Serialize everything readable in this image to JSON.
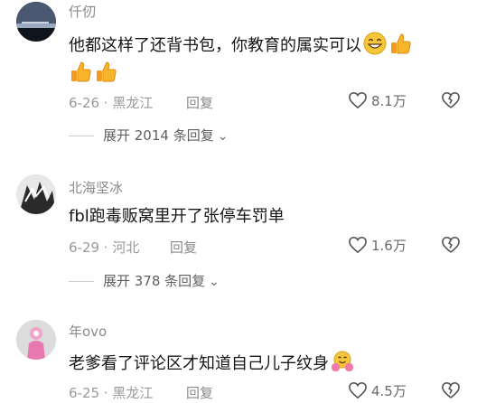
{
  "comments": [
    {
      "username": "仟仞",
      "text": "他都这样了还背书包，你教育的属实可以",
      "meta": "6-26 · 黑龙江",
      "reply_label": "回复",
      "likes": "8.1万",
      "expand_label": "展开 2014 条回复",
      "emojis": [
        "grinning-emoji",
        "thumbs-up-emoji",
        "thumbs-up-emoji",
        "thumbs-up-emoji"
      ]
    },
    {
      "username": "北海坚冰",
      "text": "fbl跑毒贩窝里开了张停车罚单",
      "meta": "6-29 · 河北",
      "reply_label": "回复",
      "likes": "1.6万",
      "expand_label": "展开 378 条回复"
    },
    {
      "username": "年ovo",
      "text": "老爹看了评论区才知道自己儿子纹身",
      "meta": "6-25 · 黑龙江",
      "reply_label": "回复",
      "likes": "4.5万",
      "emojis": [
        "hugging-emoji"
      ]
    }
  ],
  "colors": {
    "text": "#161616",
    "muted": "#8a8a8a",
    "emoji_yellow": "#f5b82e"
  }
}
